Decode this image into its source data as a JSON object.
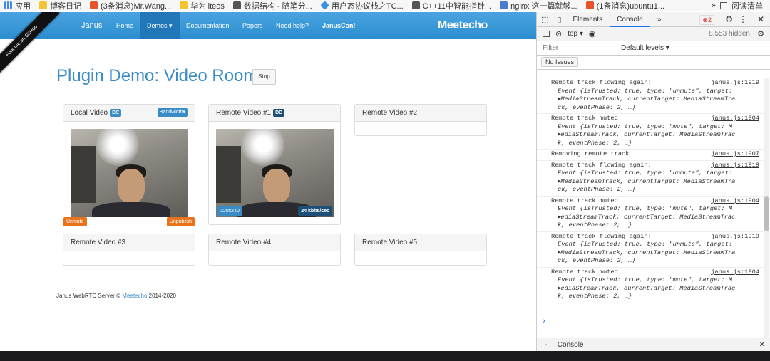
{
  "bookmarks": [
    {
      "label": "应用",
      "color": "#4285f4"
    },
    {
      "label": "博客日记",
      "color": "#f4c430"
    },
    {
      "label": "(3条消息)Mr.Wang...",
      "color": "#e8522a"
    },
    {
      "label": "华为liteos",
      "color": "#f4c430"
    },
    {
      "label": "数据结构 - 随笔分...",
      "color": "#555555"
    },
    {
      "label": "用户态协议栈之TC...",
      "color": "#3b8ee0"
    },
    {
      "label": "C++11中智能指针...",
      "color": "#555555"
    },
    {
      "label": "nginx 这一篇就够...",
      "color": "#4a7bd0"
    },
    {
      "label": "(1条消息)ubuntu1...",
      "color": "#e8522a"
    }
  ],
  "bookmarks_more": "»",
  "reading_list": "阅读清单",
  "ribbon": "Fork me on GitHub",
  "nav": {
    "brand": "Janus",
    "items": [
      "Home",
      "Demos ▾",
      "Documentation",
      "Papers",
      "Need help?",
      "JanusCon!"
    ],
    "logo": "Meetecho"
  },
  "title": "Plugin Demo: Video Room",
  "stop": "Stop",
  "panels": [
    {
      "title": "Local Video",
      "badge": "DC",
      "badge_color": "#3a8cc7",
      "extra": "Bandwidth▾"
    },
    {
      "title": "Remote Video #1",
      "badge": "DD",
      "badge_color": "#1d4f78"
    },
    {
      "title": "Remote Video #2"
    },
    {
      "title": "Remote Video #3"
    },
    {
      "title": "Remote Video #4"
    },
    {
      "title": "Remote Video #5"
    }
  ],
  "local_video": {
    "unmute": "Unmute",
    "unpublish": "Unpublish"
  },
  "remote_video": {
    "resolution": "320x240",
    "bitrate": "24 kbits/sec"
  },
  "footer": {
    "pre": "Janus WebRTC Server © ",
    "link": "Meetecho",
    "post": " 2014-2020"
  },
  "devtools": {
    "tabs": [
      "Elements",
      "Console",
      "»"
    ],
    "errors": "2",
    "context": "top ▾",
    "hidden": "8,553 hidden",
    "filter_placeholder": "Filter",
    "levels": "Default levels ▾",
    "issues": "No Issues",
    "drawer": "Console",
    "logs": [
      {
        "text": "Remote track flowing again:",
        "src": "janus.js:1919",
        "ev": [
          "Event {isTrusted: true, type: \"unmute\", target:",
          "▸MediaStreamTrack, currentTarget: MediaStreamTra",
          "ck, eventPhase: 2, …}"
        ]
      },
      {
        "text": "Remote track muted:",
        "src": "janus.js:1904",
        "ev": [
          "Event {isTrusted: true, type: \"mute\", target: M",
          "▸ediaStreamTrack, currentTarget: MediaStreamTrac",
          "k, eventPhase: 2, …}"
        ]
      },
      {
        "text": "Removing remote track",
        "src": "janus.js:1907",
        "ev": []
      },
      {
        "text": "Remote track flowing again:",
        "src": "janus.js:1919",
        "ev": [
          "Event {isTrusted: true, type: \"unmute\", target:",
          "▸MediaStreamTrack, currentTarget: MediaStreamTra",
          "ck, eventPhase: 2, …}"
        ]
      },
      {
        "text": "Remote track muted:",
        "src": "janus.js:1904",
        "ev": [
          "Event {isTrusted: true, type: \"mute\", target: M",
          "▸ediaStreamTrack, currentTarget: MediaStreamTrac",
          "k, eventPhase: 2, …}"
        ]
      },
      {
        "text": "Remote track flowing again:",
        "src": "janus.js:1919",
        "ev": [
          "Event {isTrusted: true, type: \"unmute\", target:",
          "▸MediaStreamTrack, currentTarget: MediaStreamTra",
          "ck, eventPhase: 2, …}"
        ]
      },
      {
        "text": "Remote track muted:",
        "src": "janus.js:1904",
        "ev": [
          "Event {isTrusted: true, type: \"mute\", target: M",
          "▸ediaStreamTrack, currentTarget: MediaStreamTrac",
          "k, eventPhase: 2, …}"
        ]
      }
    ],
    "prompt": "›"
  }
}
